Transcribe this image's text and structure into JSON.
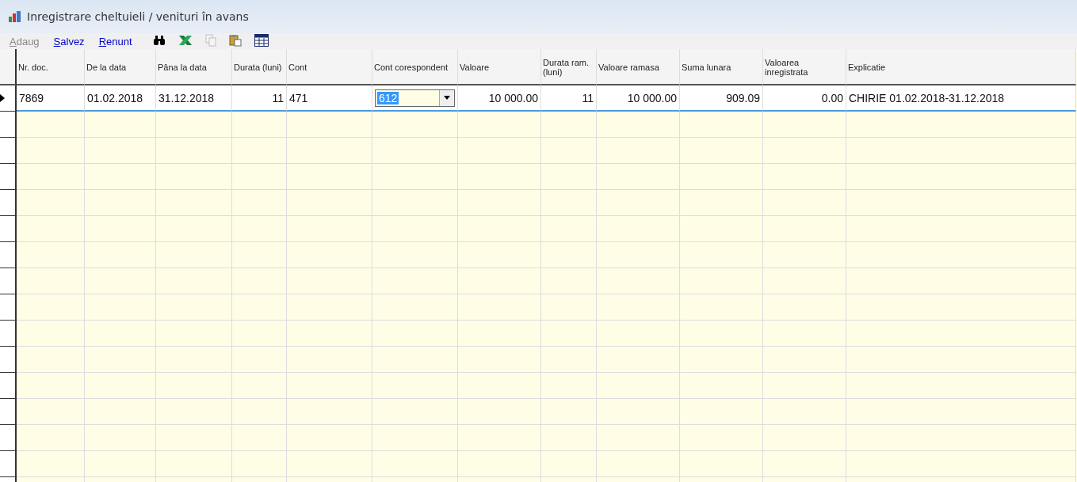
{
  "window": {
    "title": "Inregistrare cheltuieli / venituri în avans"
  },
  "toolbar": {
    "links": [
      {
        "label": "Adaug",
        "disabled": true
      },
      {
        "label": "Salvez",
        "disabled": false
      },
      {
        "label": "Renunt",
        "disabled": false
      }
    ],
    "icons": [
      {
        "kind": "binoculars",
        "disabled": false
      },
      {
        "kind": "excel",
        "disabled": false
      },
      {
        "kind": "copy",
        "disabled": true
      },
      {
        "kind": "paste",
        "disabled": false
      },
      {
        "kind": "grid",
        "disabled": false
      }
    ]
  },
  "table": {
    "columns": [
      {
        "label": "Nr. doc.",
        "kind": "text"
      },
      {
        "label": "De la data",
        "kind": "text"
      },
      {
        "label": "Pâna la data",
        "kind": "text"
      },
      {
        "label": "Durata (luni)",
        "kind": "number"
      },
      {
        "label": "Cont",
        "kind": "text"
      },
      {
        "label": "Cont corespondent",
        "kind": "text"
      },
      {
        "label": "Valoare",
        "kind": "number"
      },
      {
        "label": "Durata ram. (luni)",
        "kind": "number"
      },
      {
        "label": "Valoare ramasa",
        "kind": "number"
      },
      {
        "label": "Suma lunara",
        "kind": "number"
      },
      {
        "label": "Valoarea inregistrata",
        "kind": "number"
      },
      {
        "label": "Explicatie",
        "kind": "text"
      }
    ],
    "rows": [
      {
        "selected": true,
        "cells": [
          {
            "text": "7869"
          },
          {
            "text": "01.02.2018"
          },
          {
            "text": "31.12.2018"
          },
          {
            "text": "11"
          },
          {
            "text": "471"
          },
          {
            "text": "612",
            "kind": "dropdown"
          },
          {
            "text": "10 000.00"
          },
          {
            "text": "11"
          },
          {
            "text": "10 000.00"
          },
          {
            "text": "909.09"
          },
          {
            "text": "0.00"
          },
          {
            "text": "CHIRIE 01.02.2018-31.12.2018"
          }
        ]
      }
    ]
  }
}
